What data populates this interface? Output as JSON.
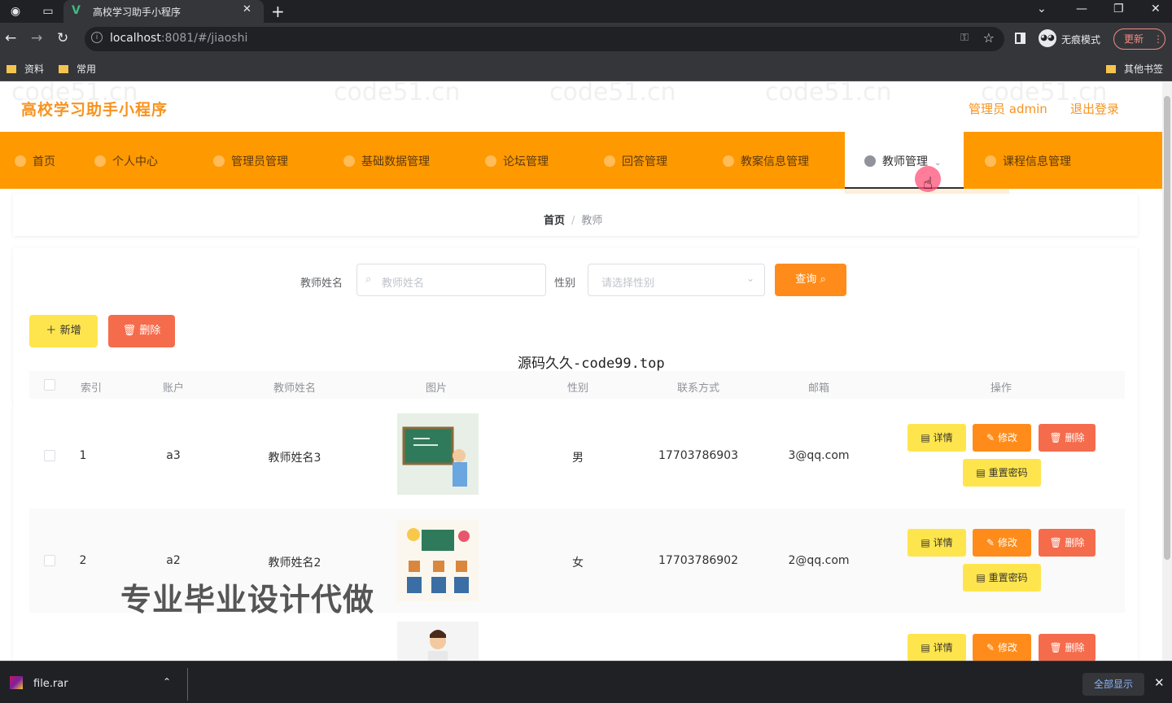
{
  "browser": {
    "tab_title": "高校学习助手小程序",
    "tab_favicon": "V",
    "url_host": "localhost",
    "url_path": ":8081/#/jiaoshi",
    "incognito_label": "无痕模式",
    "update_label": "更新",
    "bookmarks": [
      "资料",
      "常用"
    ],
    "other_bookmarks": "其他书签"
  },
  "header": {
    "site_title": "高校学习助手小程序",
    "user_info": "管理员 admin",
    "logout": "退出登录"
  },
  "menu": {
    "items": [
      {
        "label": "首页"
      },
      {
        "label": "个人中心"
      },
      {
        "label": "管理员管理"
      },
      {
        "label": "基础数据管理"
      },
      {
        "label": "论坛管理"
      },
      {
        "label": "回答管理"
      },
      {
        "label": "教案信息管理"
      },
      {
        "label": "教师管理"
      },
      {
        "label": "课程信息管理"
      }
    ],
    "active": "教师管理"
  },
  "breadcrumb": {
    "home": "首页",
    "current": "教师"
  },
  "search": {
    "name_label": "教师姓名",
    "name_placeholder": "教师姓名",
    "gender_label": "性别",
    "gender_placeholder": "请选择性别",
    "query_button": "查询"
  },
  "actions": {
    "add": "新增",
    "delete": "删除"
  },
  "watermark_center": "源码久久-code99.top",
  "watermark_text": "code51.cn",
  "table": {
    "columns": [
      "索引",
      "账户",
      "教师姓名",
      "图片",
      "性别",
      "联系方式",
      "邮箱",
      "操作"
    ],
    "rows": [
      {
        "index": "1",
        "account": "a3",
        "name": "教师姓名3",
        "gender": "男",
        "phone": "17703786903",
        "email": "3@qq.com"
      },
      {
        "index": "2",
        "account": "a2",
        "name": "教师姓名2",
        "gender": "女",
        "phone": "17703786902",
        "email": "2@qq.com"
      },
      {
        "index": "",
        "account": "",
        "name": "",
        "gender": "",
        "phone": "",
        "email": ""
      }
    ],
    "op_labels": {
      "detail": "详情",
      "edit": "修改",
      "delete": "删除",
      "reset": "重置密码"
    }
  },
  "overlay_text": "专业毕业设计代做",
  "downloads": {
    "file": "file.rar",
    "show_all": "全部显示"
  },
  "colors": {
    "accent": "#ff9900",
    "title": "#f7931e",
    "danger": "#f56c4c",
    "warning": "#ffe54d"
  }
}
